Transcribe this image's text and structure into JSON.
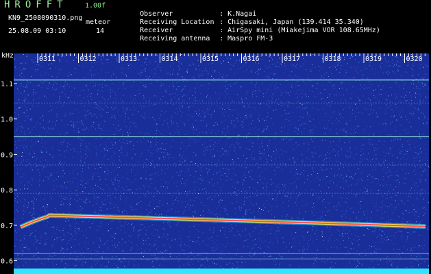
{
  "header": {
    "app_title": "HROFFT",
    "version": "1.00f",
    "filename": "KN9_2508090310.png",
    "mode": "meteor",
    "datetime": "25.08.09 03:10",
    "count": "14"
  },
  "meta": [
    {
      "label": "Observer",
      "value": "K.Nagai"
    },
    {
      "label": "Receiving Location",
      "value": "Chigasaki, Japan (139.414 35.340)"
    },
    {
      "label": "Receiver",
      "value": "AirSpy mini (Miakejima VOR 108.65MHz)"
    },
    {
      "label": "Receiving antenna",
      "value": "Maspro FM-3"
    }
  ],
  "spectrogram": {
    "y_unit": "kHz",
    "y_ticks": [
      "1.1",
      "1.0",
      "0.9",
      "0.8",
      "0.7",
      "0.6"
    ],
    "x_ticks": [
      "0311",
      "0312",
      "0313",
      "0314",
      "0315",
      "0316",
      "0317",
      "0318",
      "0319",
      "0320"
    ],
    "colors": {
      "background": "#1a2e9a",
      "noise": "#5aa8ff",
      "carrier": "#8fe8d8",
      "trail_core": "#ff5050",
      "trail_edge": "#ffe04a",
      "bottom_band": "#2ee6ff",
      "text": "#ffffff",
      "header_green": "#8cf58c"
    }
  }
}
